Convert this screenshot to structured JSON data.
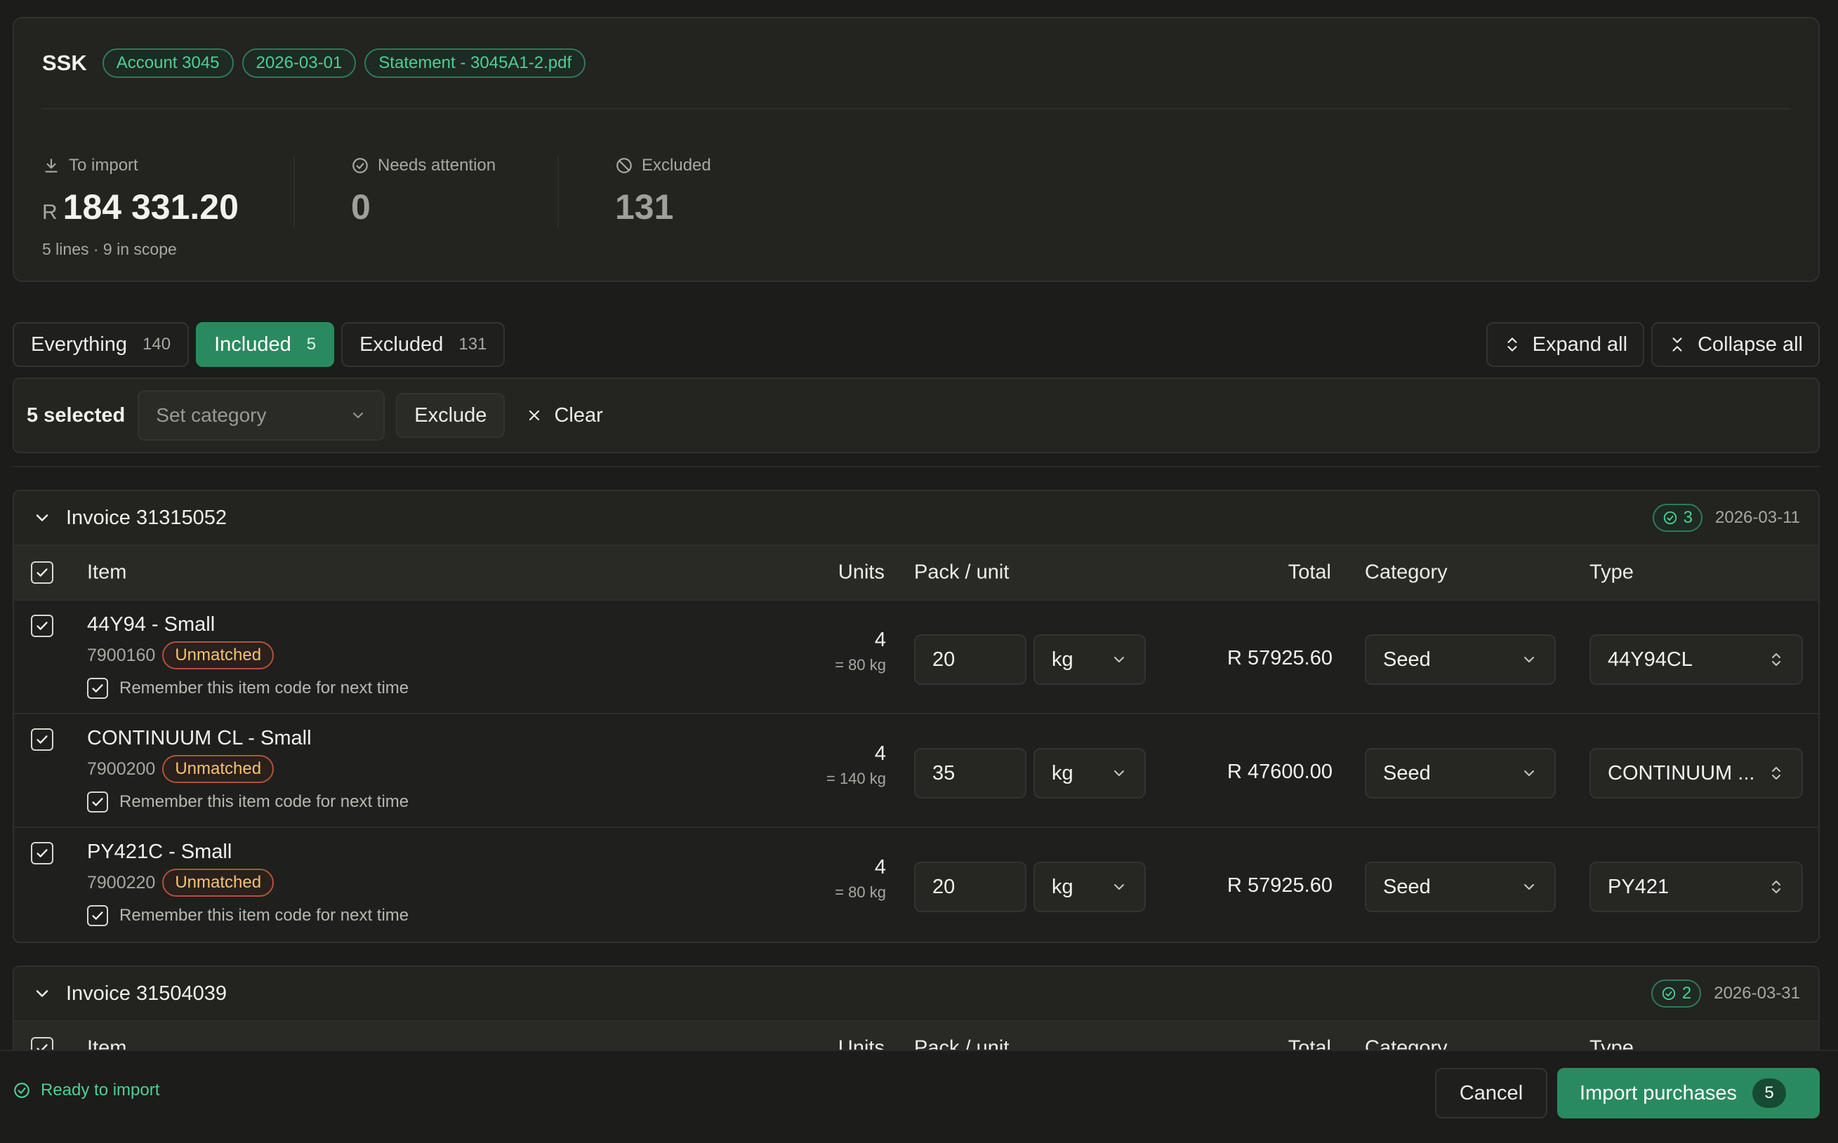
{
  "header": {
    "org": "SSK",
    "pills": [
      "Account 3045",
      "2026-03-01",
      "Statement - 3045A1-2.pdf"
    ]
  },
  "stats": {
    "to_import": {
      "label": "To import",
      "currency": "R",
      "value": "184 331.20",
      "sub": "5 lines · 9 in scope"
    },
    "needs_attention": {
      "label": "Needs attention",
      "value": "0"
    },
    "excluded": {
      "label": "Excluded",
      "value": "131"
    }
  },
  "tabs": [
    {
      "label": "Everything",
      "count": "140"
    },
    {
      "label": "Included",
      "count": "5",
      "active": true
    },
    {
      "label": "Excluded",
      "count": "131"
    }
  ],
  "toolbar": {
    "expand_all": "Expand all",
    "collapse_all": "Collapse all"
  },
  "bulk": {
    "selected": "5 selected",
    "category_placeholder": "Set category",
    "exclude": "Exclude",
    "clear": "Clear"
  },
  "columns": {
    "item": "Item",
    "units": "Units",
    "pack": "Pack / unit",
    "total": "Total",
    "category": "Category",
    "type": "Type"
  },
  "invoices": [
    {
      "title": "Invoice 31315052",
      "ok_count": "3",
      "date": "2026-03-11",
      "rows": [
        {
          "name": "44Y94 - Small",
          "code": "7900160",
          "badge": "Unmatched",
          "remember": "Remember this item code for next time",
          "units": "4",
          "units_sub": "= 80 kg",
          "pack": "20",
          "unit": "kg",
          "total": "R 57925.60",
          "category": "Seed",
          "type": "44Y94CL"
        },
        {
          "name": "CONTINUUM CL - Small",
          "code": "7900200",
          "badge": "Unmatched",
          "remember": "Remember this item code for next time",
          "units": "4",
          "units_sub": "= 140 kg",
          "pack": "35",
          "unit": "kg",
          "total": "R 47600.00",
          "category": "Seed",
          "type": "CONTINUUM ..."
        },
        {
          "name": "PY421C - Small",
          "code": "7900220",
          "badge": "Unmatched",
          "remember": "Remember this item code for next time",
          "units": "4",
          "units_sub": "= 80 kg",
          "pack": "20",
          "unit": "kg",
          "total": "R 57925.60",
          "category": "Seed",
          "type": "PY421"
        }
      ]
    },
    {
      "title": "Invoice 31504039",
      "ok_count": "2",
      "date": "2026-03-31"
    }
  ],
  "footer": {
    "status": "Ready to import",
    "cancel": "Cancel",
    "import": "Import purchases",
    "import_count": "5"
  },
  "colors": {
    "accent": "#2a8a5f",
    "accent_text": "#4ecf95",
    "warning": "#f2c374",
    "background": "#1c1c1a"
  }
}
